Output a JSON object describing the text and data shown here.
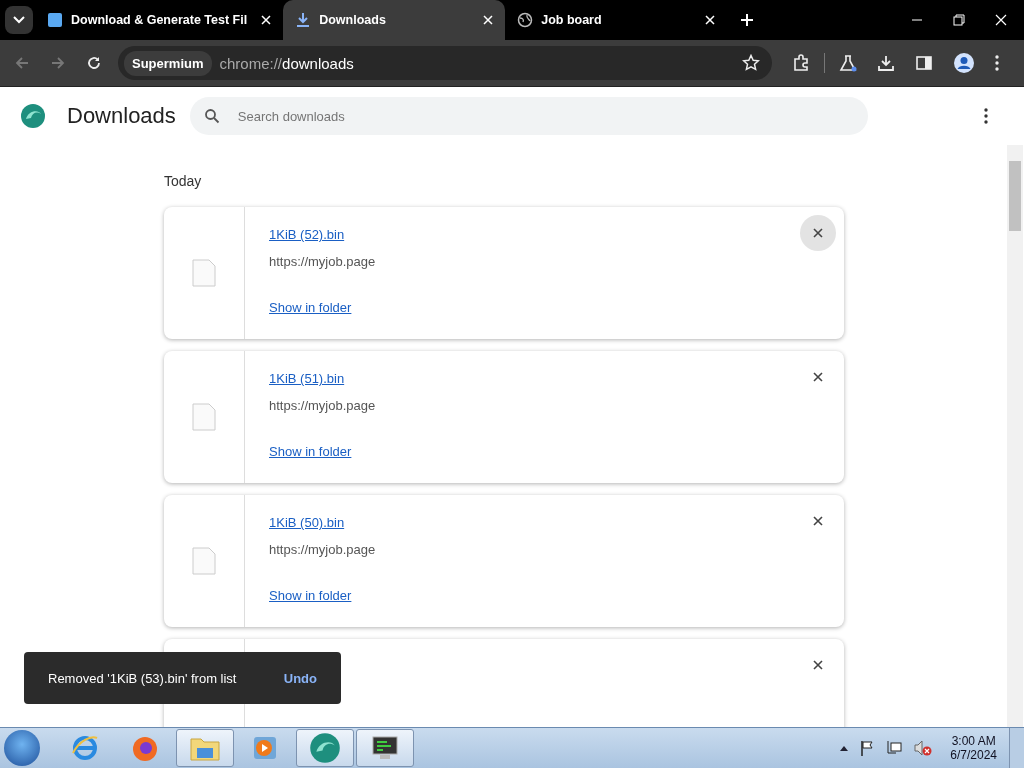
{
  "tabs": [
    {
      "title": "Download & Generate Test Fil",
      "kind": "page",
      "selected": false
    },
    {
      "title": "Downloads",
      "kind": "download",
      "selected": true
    },
    {
      "title": "Job board",
      "kind": "globe",
      "selected": false
    }
  ],
  "toolbar": {
    "site_chip": "Supermium",
    "url_scheme": "chrome://",
    "url_path": "downloads"
  },
  "header": {
    "title": "Downloads",
    "search": {
      "placeholder": "Search downloads"
    }
  },
  "section": "Today",
  "downloads": [
    {
      "name": "1KiB (52).bin",
      "url": "https://myjob.page",
      "action": "Show in folder",
      "hovered": true
    },
    {
      "name": "1KiB (51).bin",
      "url": "https://myjob.page",
      "action": "Show in folder",
      "hovered": false
    },
    {
      "name": "1KiB (50).bin",
      "url": "https://myjob.page",
      "action": "Show in folder",
      "hovered": false
    },
    {
      "hovered": false
    }
  ],
  "toast": {
    "message": "Removed '1KiB (53).bin' from list",
    "action": "Undo"
  },
  "taskbar": {
    "items": [
      {
        "kind": "ie",
        "active": false
      },
      {
        "kind": "firefox",
        "active": false
      },
      {
        "kind": "folder",
        "active": true
      },
      {
        "kind": "media",
        "active": false
      },
      {
        "kind": "browser",
        "active": true
      },
      {
        "kind": "monitor",
        "active": true
      }
    ],
    "time": "3:00 AM",
    "date": "6/7/2024"
  }
}
